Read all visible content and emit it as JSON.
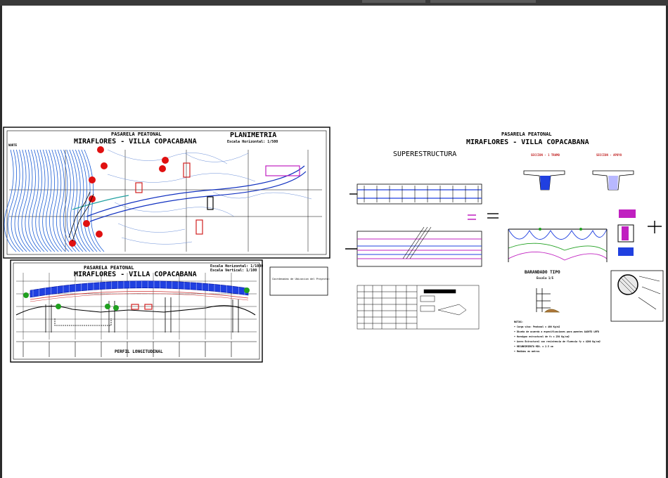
{
  "sheet1": {
    "project": "PASARELA PEATONAL",
    "title": "MIRAFLORES - VILLA COPACABANA",
    "plan_title": "PLANIMETRIA",
    "plan_scale": "Escala Horizontal: 1/500",
    "profile_scale_h": "Escala Horizontal: 1/1000",
    "profile_scale_v": "Escala Vertical: 1/100",
    "profile_title": "PERFIL LONGITUDINAL",
    "north_label": "NORTE",
    "note_box_text": "Coordenadas de Ubicacion del Proyecto:"
  },
  "sheet2": {
    "project": "PASARELA PEATONAL",
    "title": "MIRAFLORES - VILLA COPACABANA",
    "super_title": "SUPERESTRUCTURA",
    "section1": "SECCION - 1 TRAMO",
    "section2": "SECCION - APOYO",
    "railing_title": "BARANDADO TIPO",
    "railing_scale": "Escala 1/5",
    "notes_title": "NOTAS:",
    "notes": [
      "Carga viva: Peatonal = 400 Kg/m2",
      "Diseño de acuerdo a especificaciones para puentes AASHTO LRFD",
      "Hormigon estructural de fc = 250 Kg/cm2",
      "Acero Estructural con resistencia de fluencia fy = 4200 Kg/cm2",
      "RECUBRIMIENTO MIN. = 2.5 cm",
      "Medidas en metros"
    ]
  },
  "colors": {
    "background": "#ffffff",
    "frame": "#2b2b2b",
    "contour": "#1e5fd6",
    "road": "#1030c0",
    "trees": "#e01010",
    "cars": "#d02020",
    "deck": "#2040e0",
    "magenta": "#c020c0",
    "green": "#20a020"
  }
}
